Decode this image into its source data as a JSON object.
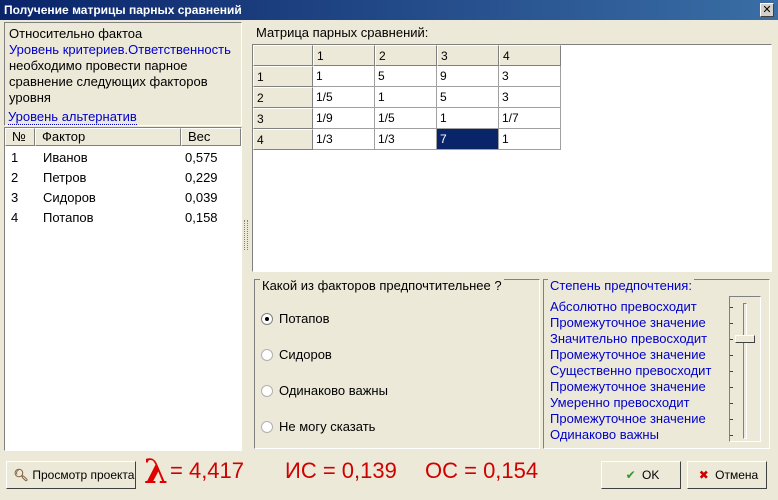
{
  "window": {
    "title": "Получение матрицы парных сравнений",
    "close_label": "✕"
  },
  "info": {
    "line1": "Относительно фактоа",
    "line2": "Уровень критериев.Ответственность",
    "line3": "необходимо провести парное",
    "line4": "сравнение следующих факторов",
    "line5": "уровня",
    "line6": "Уровень альтернатив"
  },
  "factors": {
    "headers": {
      "num": "№",
      "name": "Фактор",
      "weight": "Вес"
    },
    "rows": [
      {
        "num": "1",
        "name": "Иванов",
        "weight": "0,575"
      },
      {
        "num": "2",
        "name": "Петров",
        "weight": "0,229"
      },
      {
        "num": "3",
        "name": "Сидоров",
        "weight": "0,039"
      },
      {
        "num": "4",
        "name": "Потапов",
        "weight": "0,158"
      }
    ]
  },
  "matrix": {
    "title": "Матрица парных сравнений:",
    "col_headers": [
      "1",
      "2",
      "3",
      "4"
    ],
    "row_headers": [
      "1",
      "2",
      "3",
      "4"
    ],
    "cells": [
      [
        "1",
        "5",
        "9",
        "3"
      ],
      [
        "1/5",
        "1",
        "5",
        "3"
      ],
      [
        "1/9",
        "1/5",
        "1",
        "1/7"
      ],
      [
        "1/3",
        "1/3",
        "7",
        "1"
      ]
    ],
    "selected_value": "7"
  },
  "question": {
    "title": "Какой из факторов предпочтительнее ?",
    "options": [
      "Потапов",
      "Сидоров",
      "Одинаково важны",
      "Не могу сказать"
    ],
    "selected": "Потапов"
  },
  "preference": {
    "title": "Степень предпочтения:",
    "items": [
      "Абсолютно превосходит",
      "Промежуточное значение",
      "Значительно превосходит",
      "Промежуточное значение",
      "Существенно превосходит",
      "Промежуточное значение",
      "Умеренно превосходит",
      "Промежуточное значение",
      "Одинаково важны"
    ],
    "slider_level_index": 2
  },
  "footer": {
    "preview_button": "Просмотр проекта",
    "lambda_symbol": "λ",
    "lambda_value": "= 4,417",
    "is_value": "ИС = 0,139",
    "os_value": "ОС = 0,154",
    "ok_button": "OK",
    "cancel_button": "Отмена"
  }
}
